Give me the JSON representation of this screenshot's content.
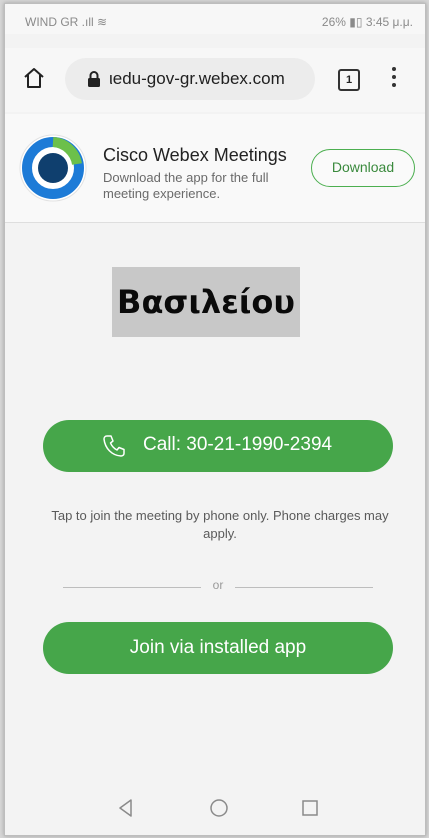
{
  "status_bar": {
    "carrier": "WIND GR",
    "signal_glyphs": "⁠.ıll ≋",
    "battery_time": "26% ▮▯ 3:45 μ.μ."
  },
  "browser": {
    "url": "ιedu-gov-gr.webex.com",
    "tab_count": "1"
  },
  "banner": {
    "app_name": "Cisco Webex Meetings",
    "description": "Download the app for the full meeting experience.",
    "download_label": "Download"
  },
  "meeting": {
    "name": "Βασιλείου"
  },
  "call": {
    "label": "Call: 30-21-1990-2394",
    "note": "Tap to join the meeting by phone only. Phone charges may apply."
  },
  "divider": {
    "text": "or"
  },
  "join": {
    "label": "Join via installed app"
  },
  "colors": {
    "accent_green": "#46a64a",
    "logo_blue": "#1d7bd7",
    "logo_green": "#6cc04a"
  },
  "icons": [
    "home-icon",
    "lock-icon",
    "tabs-icon",
    "menu-icon",
    "phone-icon",
    "back-icon",
    "home-circle-icon",
    "recents-icon"
  ]
}
